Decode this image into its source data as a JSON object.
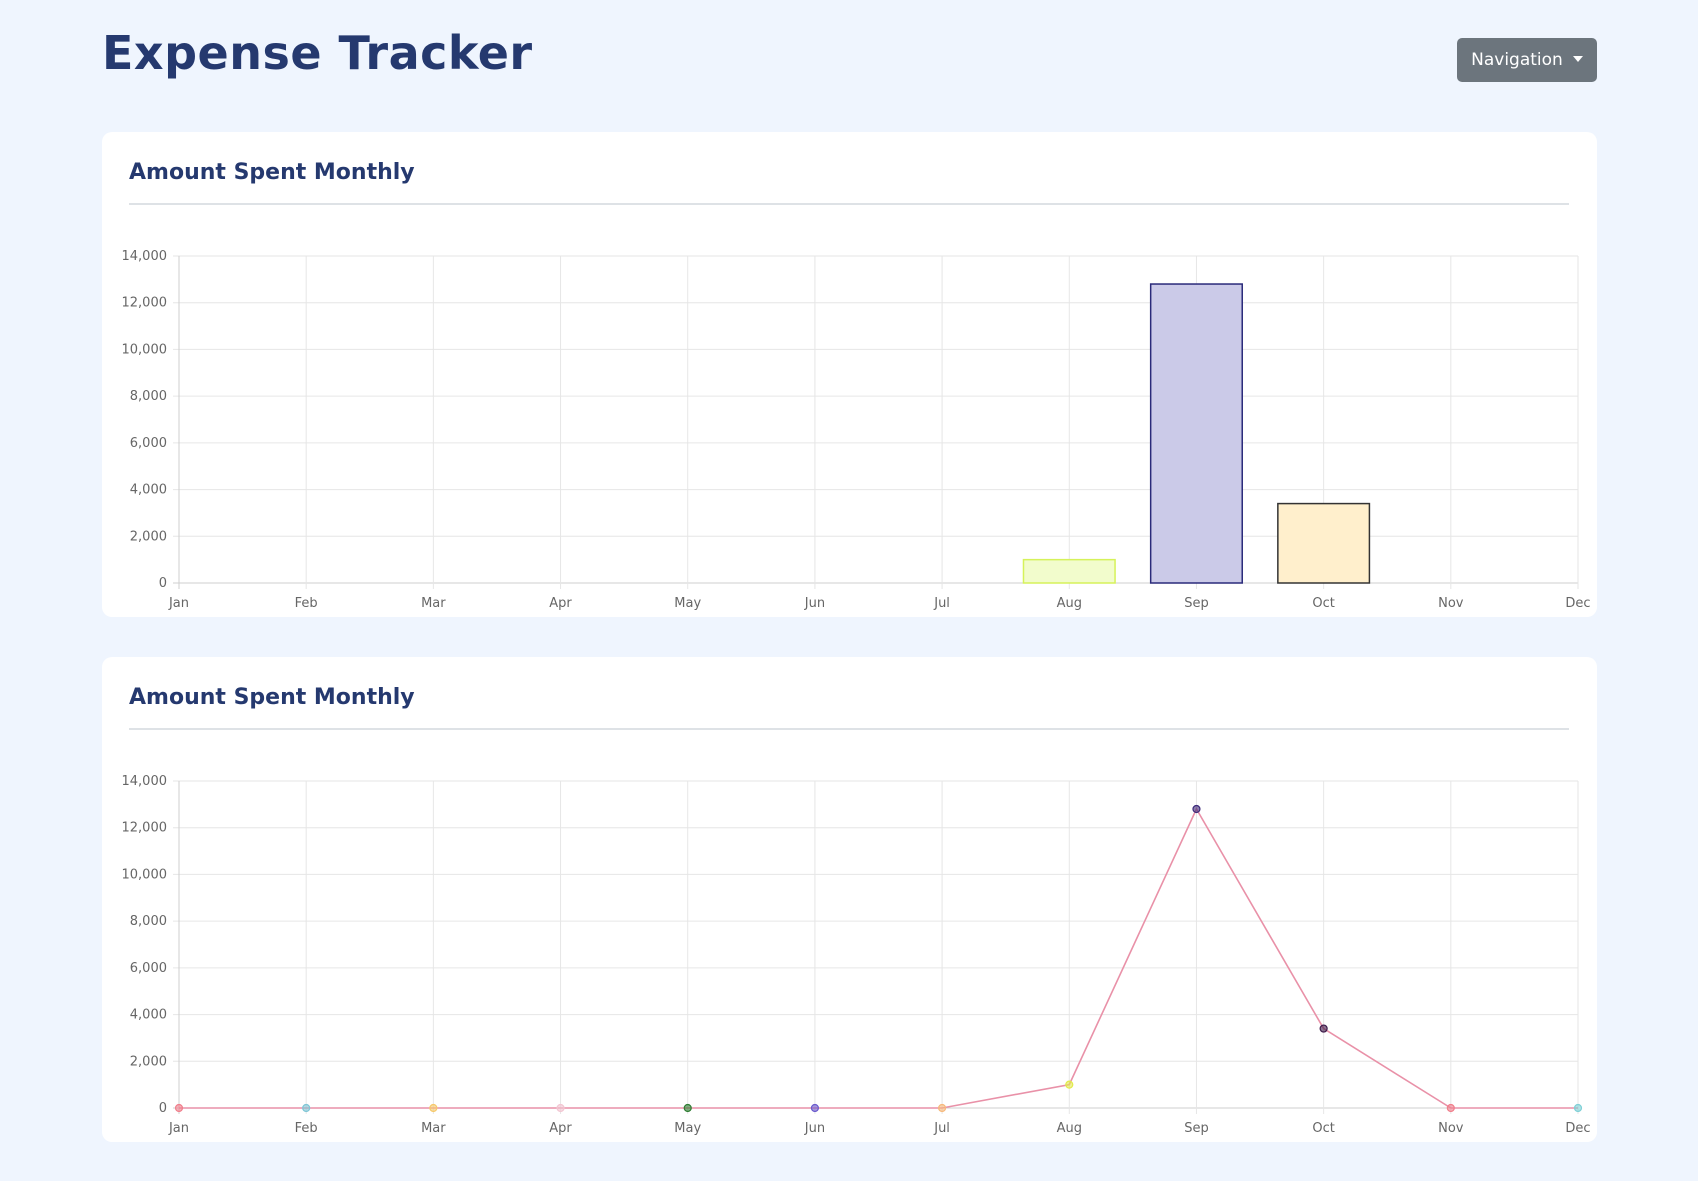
{
  "header": {
    "title": "Expense Tracker",
    "nav_button_label": "Navigation"
  },
  "cards": {
    "bar": {
      "title": "Amount Spent Monthly"
    },
    "line": {
      "title": "Amount Spent Monthly"
    }
  },
  "chart_data": [
    {
      "type": "bar",
      "title": "Amount Spent Monthly",
      "categories": [
        "Jan",
        "Feb",
        "Mar",
        "Apr",
        "May",
        "Jun",
        "Jul",
        "Aug",
        "Sep",
        "Oct",
        "Nov",
        "Dec"
      ],
      "values": [
        0,
        0,
        0,
        0,
        0,
        0,
        0,
        1000,
        12800,
        3400,
        0,
        0
      ],
      "ylim": [
        0,
        14000
      ],
      "yticks": [
        0,
        2000,
        4000,
        6000,
        8000,
        10000,
        12000,
        14000
      ],
      "ytick_labels": [
        "0",
        "2,000",
        "4,000",
        "6,000",
        "8,000",
        "10,000",
        "12,000",
        "14,000"
      ],
      "grid": true,
      "bar_colors": {
        "Aug": {
          "fill": "#f2fccc",
          "stroke": "#d6f25a"
        },
        "Sep": {
          "fill": "#cbcae8",
          "stroke": "#2a2a7a"
        },
        "Oct": {
          "fill": "#ffefcc",
          "stroke": "#333333"
        }
      }
    },
    {
      "type": "line",
      "title": "Amount Spent Monthly",
      "categories": [
        "Jan",
        "Feb",
        "Mar",
        "Apr",
        "May",
        "Jun",
        "Jul",
        "Aug",
        "Sep",
        "Oct",
        "Nov",
        "Dec"
      ],
      "values": [
        0,
        0,
        0,
        0,
        0,
        0,
        0,
        1000,
        12800,
        3400,
        0,
        0
      ],
      "ylim": [
        0,
        14000
      ],
      "yticks": [
        0,
        2000,
        4000,
        6000,
        8000,
        10000,
        12000,
        14000
      ],
      "ytick_labels": [
        "0",
        "2,000",
        "4,000",
        "6,000",
        "8,000",
        "10,000",
        "12,000",
        "14,000"
      ],
      "grid": true,
      "line_color": "#e991a8",
      "point_colors": [
        "#f07f8c",
        "#7fc6d6",
        "#f6c96b",
        "#f2c6d2",
        "#2e7d32",
        "#6a5acd",
        "#f6b97c",
        "#e2ea4a",
        "#3d2a7a",
        "#3d1a4a",
        "#f07f8c",
        "#7fd0d6"
      ]
    }
  ]
}
